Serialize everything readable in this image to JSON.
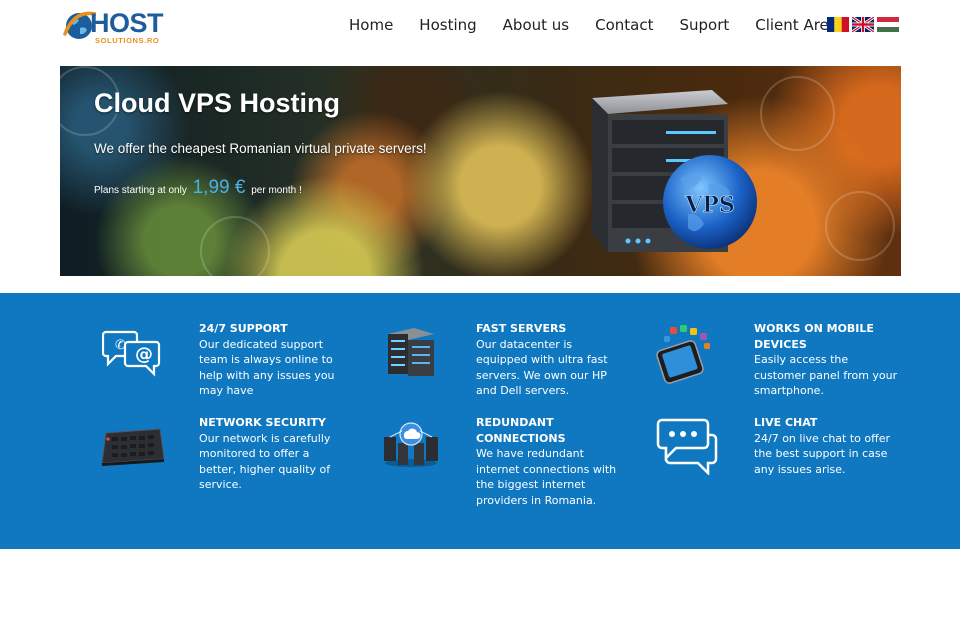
{
  "brand": {
    "name": "HOST",
    "sub": "SOLUTIONS.RO",
    "colors": {
      "primary": "#1c5d9b",
      "accent": "#e8901e"
    }
  },
  "nav": {
    "items": [
      "Home",
      "Hosting",
      "About us",
      "Contact",
      "Suport",
      "Client Area"
    ]
  },
  "flags": [
    "romania-flag",
    "uk-flag",
    "hungary-flag"
  ],
  "banner": {
    "title": "Cloud VPS Hosting",
    "subtitle": "We offer the cheapest Romanian virtual private servers!",
    "price_prefix": "Plans starting at only",
    "price": "1,99 €",
    "price_suffix": "per month !",
    "server_label": "VPS"
  },
  "features": {
    "background": "#0f78c1",
    "items": [
      {
        "icon": "chat-email-icon",
        "title": "24/7 SUPPORT",
        "text": "Our dedicated support team is always online to help with any issues you may have"
      },
      {
        "icon": "server-rack-icon",
        "title": "FAST SERVERS",
        "text": "Our datacenter is equipped with ultra fast servers. We own our HP and Dell servers."
      },
      {
        "icon": "smartphone-apps-icon",
        "title": "WORKS ON MOBILE DEVICES",
        "text": "Easily access the customer panel from your smartphone."
      },
      {
        "icon": "network-switch-icon",
        "title": "NETWORK SECURITY",
        "text": "Our network is carefully monitored to offer a better, higher quality of service."
      },
      {
        "icon": "cloud-network-icon",
        "title": "REDUNDANT CONNECTIONS",
        "text": "We have redundant internet connections with the biggest internet providers in Romania."
      },
      {
        "icon": "live-chat-icon",
        "title": "LIVE CHAT",
        "text": "24/7 on live chat to offer the best support in case any issues arise."
      }
    ]
  }
}
